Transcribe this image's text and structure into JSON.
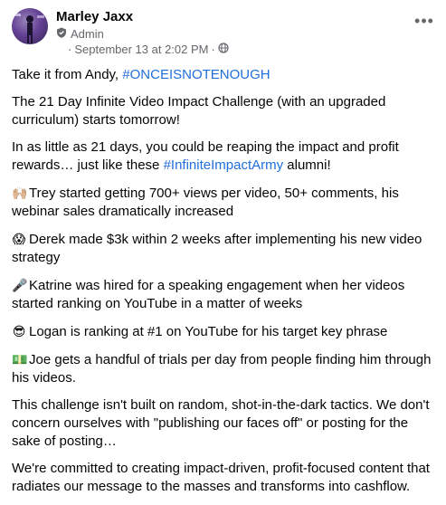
{
  "author": {
    "name": "Marley Jaxx",
    "role": "Admin"
  },
  "meta": {
    "date": "September 13 at 2:02 PM",
    "separator": "·"
  },
  "icons": {
    "admin": "shield-icon",
    "audience": "globe-icon",
    "more": "more-options-icon"
  },
  "colors": {
    "hashtag": "#216fdb",
    "meta": "#65676b",
    "text": "#050505"
  },
  "post": {
    "p1_text": "Take it from Andy, ",
    "p1_tag": "#ONCEISNOTENOUGH",
    "p2": "The 21 Day Infinite Video Impact Challenge (with an upgraded curriculum) starts tomorrow!",
    "p3_text": "In as little as 21 days, you could be reaping the impact and profit rewards… just like these ",
    "p3_tag": "#InfiniteImpactArmy",
    "p3_end": " alumni!",
    "items": [
      {
        "emoji": "🙌🏼",
        "text": "Trey started getting 700+ views per video, 50+ comments, his webinar sales dramatically increased"
      },
      {
        "emoji": "😱",
        "text": "Derek made $3k within 2 weeks after implementing his new video strategy"
      },
      {
        "emoji": "🎤",
        "text": "Katrine was hired for a speaking engagement when her videos started ranking on YouTube in a matter of weeks"
      },
      {
        "emoji": "😎",
        "text": "Logan is ranking at #1 on YouTube for his target key phrase"
      },
      {
        "emoji": "💵",
        "text": "Joe gets a handful of trials per day from people finding him through his videos."
      }
    ],
    "p4": "This challenge isn't built on random, shot-in-the-dark tactics. We don't concern ourselves with \"publishing our faces off\" or posting for the sake of posting…",
    "p5": "We're committed to creating impact-driven, profit-focused content that radiates our message to the masses and transforms into cashflow."
  }
}
